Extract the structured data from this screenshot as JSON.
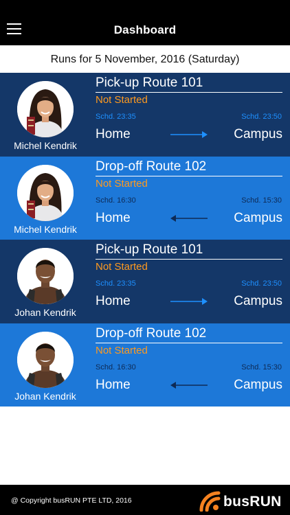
{
  "header": {
    "title": "Dashboard",
    "menu_icon": "hamburger-menu-icon"
  },
  "date_label": "Runs for 5 November, 2016 (Saturday)",
  "colors": {
    "header_bg": "#000000",
    "row_dark": "#143768",
    "row_light": "#1d78d8",
    "status_orange": "#ff9a1f",
    "schedule_blue": "#1e90ff"
  },
  "runs": [
    {
      "student": "Michel Kendrik",
      "route": "Pick-up Route 101",
      "status": "Not Started",
      "schd_left": "Schd. 23:35",
      "schd_right": "Schd. 23:50",
      "from": "Home",
      "to": "Campus",
      "direction": "right-arrow-icon"
    },
    {
      "student": "Michel Kendrik",
      "route": "Drop-off Route 102",
      "status": "Not Started",
      "schd_left": "Schd. 16:30",
      "schd_right": "Schd. 15:30",
      "from": "Home",
      "to": "Campus",
      "direction": "left-arrow-icon"
    },
    {
      "student": "Johan Kendrik",
      "route": "Pick-up Route 101",
      "status": "Not Started",
      "schd_left": "Schd. 23:35",
      "schd_right": "Schd. 23:50",
      "from": "Home",
      "to": "Campus",
      "direction": "right-arrow-icon"
    },
    {
      "student": "Johan Kendrik",
      "route": "Drop-off Route 102",
      "status": "Not Started",
      "schd_left": "Schd. 16:30",
      "schd_right": "Schd. 15:30",
      "from": "Home",
      "to": "Campus",
      "direction": "left-arrow-icon"
    }
  ],
  "footer": {
    "copyright": "@ Copyright busRUN PTE LTD, 2016",
    "logo_text": "busRUN",
    "logo_icon": "wifi-signal-icon"
  }
}
